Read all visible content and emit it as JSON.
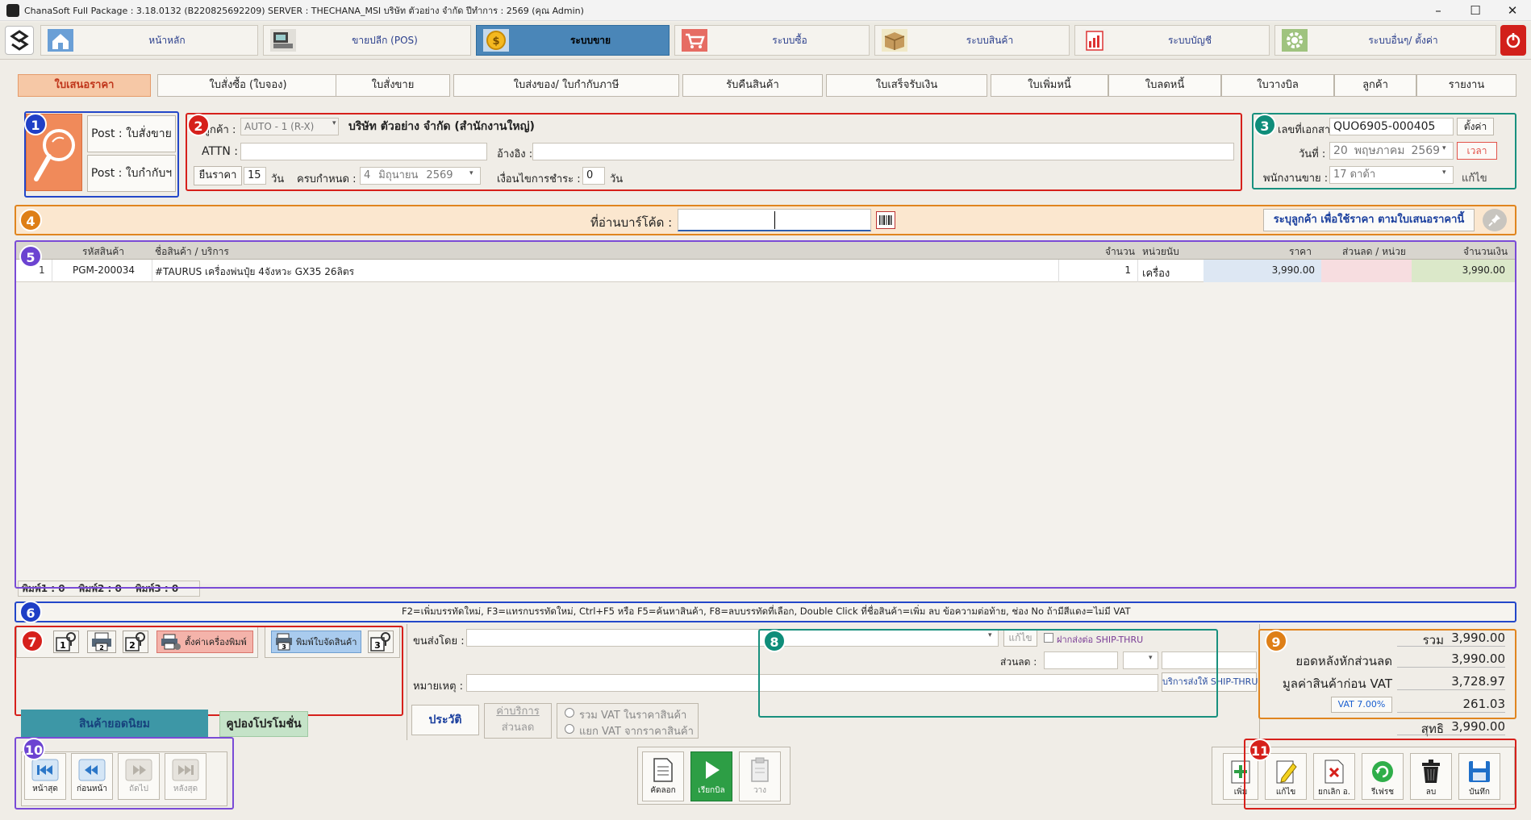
{
  "window": {
    "title": "ChanaSoft Full Package : 3.18.0132 (B220825692209) SERVER : THECHANA_MSI บริษัท ตัวอย่าง จำกัด ปีทำการ : 2569 (คุณ Admin)"
  },
  "modules": [
    {
      "label": "หน้าหลัก",
      "icon": "home-icon"
    },
    {
      "label": "ขายปลีก (POS)",
      "icon": "pos-terminal-icon"
    },
    {
      "label": "ระบบขาย",
      "icon": "coin-icon"
    },
    {
      "label": "ระบบซื้อ",
      "icon": "cart-icon"
    },
    {
      "label": "ระบบสินค้า",
      "icon": "box-icon"
    },
    {
      "label": "ระบบบัญชี",
      "icon": "ledger-icon"
    },
    {
      "label": "ระบบอื่นๆ/ ตั้งค่า",
      "icon": "gear-icon"
    }
  ],
  "tabs": [
    "ใบเสนอราคา",
    "ใบสั่งซื้อ (ใบจอง)",
    "ใบสั่งขาย",
    "ใบส่งของ/ ใบกำกับภาษี",
    "รับคืนสินค้า",
    "ใบเสร็จรับเงิน",
    "ใบเพิ่มหนี้",
    "ใบลดหนี้",
    "ใบวางบิล",
    "ลูกค้า",
    "รายงาน"
  ],
  "badges": [
    "1",
    "2",
    "3",
    "4",
    "5",
    "6",
    "7",
    "8",
    "9",
    "10",
    "11"
  ],
  "post": {
    "to_order": "Post : ใบสั่งขาย",
    "to_invoice": "Post : ใบกำกับฯ"
  },
  "customer": {
    "label": "ลูกค้า :",
    "code": "AUTO - 1 (R-X)",
    "name": "บริษัท ตัวอย่าง จำกัด (สำนักงานใหญ่)",
    "attn_label": "ATTN :",
    "ref_label": "อ้างอิง :",
    "confirm_label": "ยืนราคา",
    "confirm_days": "15",
    "days_unit": "วัน",
    "due_label": "ครบกำหนด :",
    "due_day": "4",
    "due_month": "มิถุนายน",
    "due_year": "2569",
    "payterm_label": "เงื่อนไขการชำระ :",
    "payterm_days": "0",
    "payterm_unit": "วัน"
  },
  "doc": {
    "no_label": "เลขที่เอกสาร :",
    "no": "QUO6905-000405",
    "set_label": "ตั้งค่า",
    "date_label": "วันที่ :",
    "date_day": "20",
    "date_month": "พฤษภาคม",
    "date_year": "2569",
    "time_label": "เวลา",
    "sales_label": "พนักงานขาย :",
    "sales": "17 ดาด้า",
    "edit_label": "แก้ไข"
  },
  "barcode": {
    "label": "ที่อ่านบาร์โค้ด :",
    "spec_btn": "ระบุลูกค้า เพื่อใช้ราคา ตามใบเสนอราคานี้"
  },
  "grid": {
    "headers": [
      "รหัสสินค้า",
      "ชื่อสินค้า / บริการ",
      "จำนวน",
      "หน่วยนับ",
      "ราคา",
      "ส่วนลด / หน่วย",
      "จำนวนเงิน"
    ],
    "rows": [
      {
        "no": "1",
        "code": "PGM-200034",
        "name": "#TAURUS เครื่องพ่นปุ๋ย 4จังหวะ GX35 26ลิตร",
        "qty": "1",
        "unit": "เครื่อง",
        "price": "3,990.00",
        "discount": "",
        "amount": "3,990.00"
      }
    ]
  },
  "print_counts": "พิมพ์1 : 0    พิมพ์2 : 0    พิมพ์3 : 0",
  "hint": "F2=เพิ่มบรรทัดใหม่, F3=แทรกบรรทัดใหม่, Ctrl+F5 หรือ F5=ค้นหาสินค้า, F8=ลบบรรทัดที่เลือก, Double Click ที่ชื่อสินค้า=เพิ่ม ลบ ข้อความต่อท้าย, ช่อง No ถ้ามีสีแดง=ไม่มี VAT",
  "print_buttons": {
    "printer_settings": "ตั้งค่าเครื่องพิมพ์",
    "print_picking": "พิมพ์ใบจัดสินค้า"
  },
  "shipping": {
    "by_label": "ขนส่งโดย :",
    "edit": "แก้ไข",
    "ship_thru": "ฝากส่งต่อ SHIP-THRU",
    "discount_label": "ส่วนลด :",
    "ship_service": "บริการส่งให้ SHIP-THRU"
  },
  "remark_label": "หมายเหตุ :",
  "side_tabs": {
    "popular": "สินค้ายอดนิยม",
    "coupon": "คูปองโปรโมชั่น"
  },
  "options": {
    "history": "ประวัติ",
    "service_fee": "ค่าบริการ",
    "discount": "ส่วนลด",
    "vat_incl": "รวม VAT ในราคาสินค้า",
    "vat_excl": "แยก VAT จากราคาสินค้า"
  },
  "totals": {
    "sum_label": "รวม",
    "sum": "3,990.00",
    "after_disc_label": "ยอดหลังหักส่วนลด",
    "after_disc": "3,990.00",
    "before_vat_label": "มูลค่าสินค้าก่อน VAT",
    "before_vat": "3,728.97",
    "vat_label": "VAT 7.00%",
    "vat": "261.03",
    "net_label": "สุทธิ",
    "net": "3,990.00"
  },
  "nav": {
    "first": "หน้าสุด",
    "prev": "ก่อนหน้า",
    "next": "ถัดไป",
    "last": "หลังสุด"
  },
  "center_buttons": {
    "copy": "คัดลอก",
    "bill": "เรียกบิล",
    "paste": "วาง"
  },
  "actions": {
    "add": "เพิ่ม",
    "edit": "แก้ไข",
    "cancel": "ยกเลิก อ.",
    "refresh": "รีเฟรช",
    "delete": "ลบ",
    "save": "บันทึก"
  }
}
